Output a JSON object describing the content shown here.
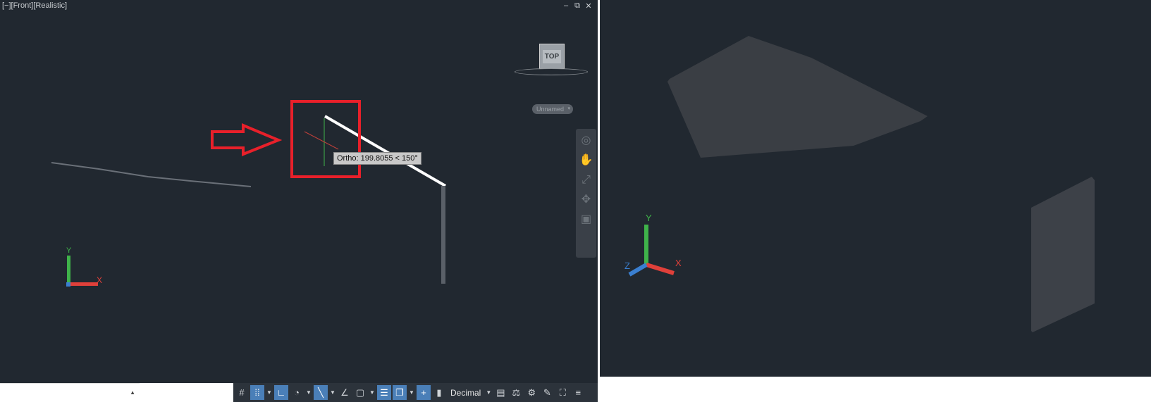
{
  "left_viewport": {
    "label": "[−][Front][Realistic]",
    "window_controls": [
      "–",
      "⧉",
      "✕"
    ],
    "tooltip": "Ortho: 199.8055 < 150°",
    "viewcube_label": "TOP",
    "named_view": "Unnamed",
    "ucs": {
      "x_label": "X",
      "y_label": "Y"
    }
  },
  "right_viewport": {
    "ucs": {
      "x_label": "X",
      "y_label": "Y",
      "z_label": "Z"
    }
  },
  "navbar_icons": [
    "steering-wheel-icon",
    "pan-hand-icon",
    "zoom-icon",
    "orbit-icon",
    "showmotion-icon"
  ],
  "status_bar": {
    "units": "Decimal",
    "toggles": [
      {
        "name": "grid-display",
        "on": false
      },
      {
        "name": "snap-mode",
        "on": true
      },
      {
        "name": "ortho-mode",
        "on": true
      },
      {
        "name": "polar-tracking",
        "on": false
      },
      {
        "name": "isometric-drafting",
        "on": true
      },
      {
        "name": "object-snap-tracking",
        "on": false
      },
      {
        "name": "object-snap",
        "on": false
      },
      {
        "name": "lineweight",
        "on": true
      },
      {
        "name": "transparency",
        "on": true
      },
      {
        "name": "selection-cycling",
        "on": true
      }
    ]
  },
  "colors": {
    "viewport_bg": "#212830",
    "highlight_red": "#e8202a",
    "status_active": "#4a7fb8",
    "axis_x": "#e0403a",
    "axis_y": "#3fb34a",
    "axis_z": "#3a7fd0"
  }
}
